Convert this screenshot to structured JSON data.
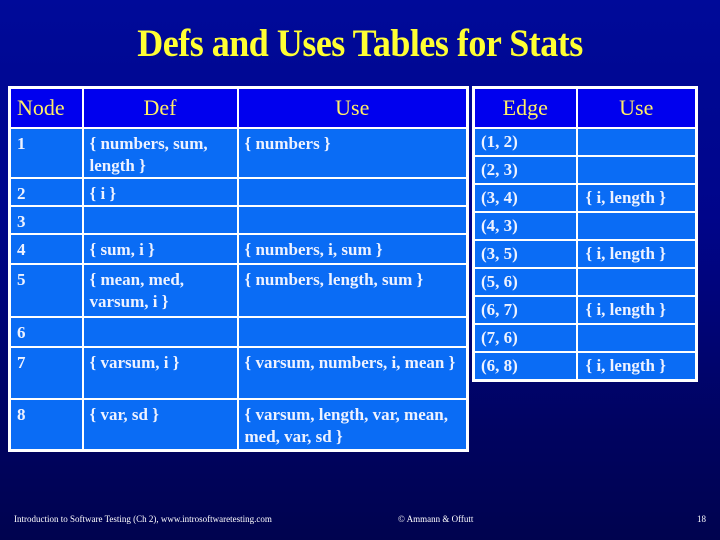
{
  "title": "Defs and Uses Tables for Stats",
  "colors": {
    "background_top": "#000a99",
    "background_bottom": "#00034f",
    "title_text": "#ffff33",
    "header_cell": "#0000ee",
    "header_text": "#ffee66",
    "body_cell": "#0a6cf5",
    "body_text": "#eef2ff",
    "grid_lines": "#ffffff"
  },
  "node_table": {
    "headers": [
      "Node",
      "Def",
      "Use"
    ],
    "rows": [
      {
        "node": "1",
        "def": "{ numbers, sum, length }",
        "use": "{ numbers }"
      },
      {
        "node": "2",
        "def": "{ i }",
        "use": ""
      },
      {
        "node": "3",
        "def": "",
        "use": ""
      },
      {
        "node": "4",
        "def": "{ sum, i }",
        "use": "{ numbers, i, sum }"
      },
      {
        "node": "5",
        "def": "{ mean, med, varsum, i }",
        "use": "{ numbers, length, sum }"
      },
      {
        "node": "6",
        "def": "",
        "use": ""
      },
      {
        "node": "7",
        "def": "{ varsum, i }",
        "use": "{ varsum, numbers, i, mean }"
      },
      {
        "node": "8",
        "def": "{ var, sd }",
        "use": "{ varsum, length, var, mean, med, var, sd }"
      }
    ]
  },
  "edge_table": {
    "headers": [
      "Edge",
      "Use"
    ],
    "rows": [
      {
        "edge": "(1, 2)",
        "use": ""
      },
      {
        "edge": "(2, 3)",
        "use": ""
      },
      {
        "edge": "(3, 4)",
        "use": "{ i, length }"
      },
      {
        "edge": "(4, 3)",
        "use": ""
      },
      {
        "edge": "(3, 5)",
        "use": "{ i, length }"
      },
      {
        "edge": "(5, 6)",
        "use": ""
      },
      {
        "edge": "(6, 7)",
        "use": "{ i, length }"
      },
      {
        "edge": "(7, 6)",
        "use": ""
      },
      {
        "edge": "(6, 8)",
        "use": "{ i, length }"
      }
    ]
  },
  "footer": {
    "left": "Introduction to Software Testing (Ch 2), www.introsoftwaretesting.com",
    "center": "© Ammann & Offutt",
    "page_number": "18"
  }
}
